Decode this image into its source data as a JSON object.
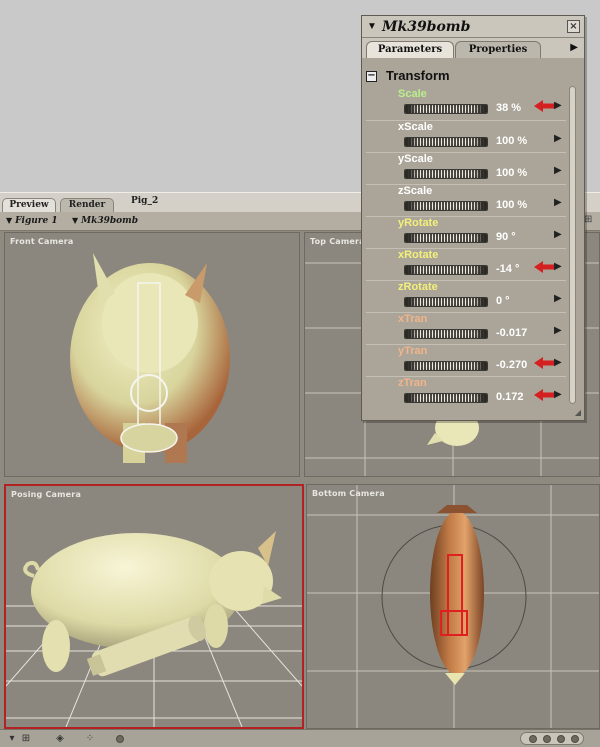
{
  "tabs": {
    "preview": "Preview",
    "render": "Render",
    "document": "Pig_2"
  },
  "figure_bar": {
    "figure": "Figure 1",
    "actor": "Mk39bomb"
  },
  "viewports": {
    "front": "Front Camera",
    "top": "Top Camera",
    "posing": "Posing Camera",
    "bottom": "Bottom Camera"
  },
  "palette": {
    "title": "Mk39bomb",
    "tabs": {
      "parameters": "Parameters",
      "properties": "Properties"
    },
    "group": "Transform",
    "params": [
      {
        "name": "Scale",
        "value": "38 %",
        "color": "#b7f08c",
        "highlighted": true
      },
      {
        "name": "xScale",
        "value": "100 %",
        "color": "#ffffff",
        "highlighted": false
      },
      {
        "name": "yScale",
        "value": "100 %",
        "color": "#ffffff",
        "highlighted": false
      },
      {
        "name": "zScale",
        "value": "100 %",
        "color": "#ffffff",
        "highlighted": false
      },
      {
        "name": "yRotate",
        "value": "90 °",
        "color": "#f3f07a",
        "highlighted": false
      },
      {
        "name": "xRotate",
        "value": "-14 °",
        "color": "#f3f07a",
        "highlighted": true
      },
      {
        "name": "zRotate",
        "value": "0 °",
        "color": "#f3f07a",
        "highlighted": false
      },
      {
        "name": "xTran",
        "value": "-0.017",
        "color": "#f2b48a",
        "highlighted": false
      },
      {
        "name": "yTran",
        "value": "-0.270",
        "color": "#f2b48a",
        "highlighted": true
      },
      {
        "name": "zTran",
        "value": "0.172",
        "color": "#f2b48a",
        "highlighted": true
      }
    ]
  },
  "colors": {
    "annotation_arrow": "#d42020",
    "active_viewport_border": "#b22222",
    "pig_body": "#e8e4b0",
    "pig_shadow": "#b86a3a"
  },
  "icons": {
    "close": "close-icon",
    "menu": "triangle-down-icon",
    "collapse": "minus-box-icon",
    "more": "triangle-right-icon"
  }
}
